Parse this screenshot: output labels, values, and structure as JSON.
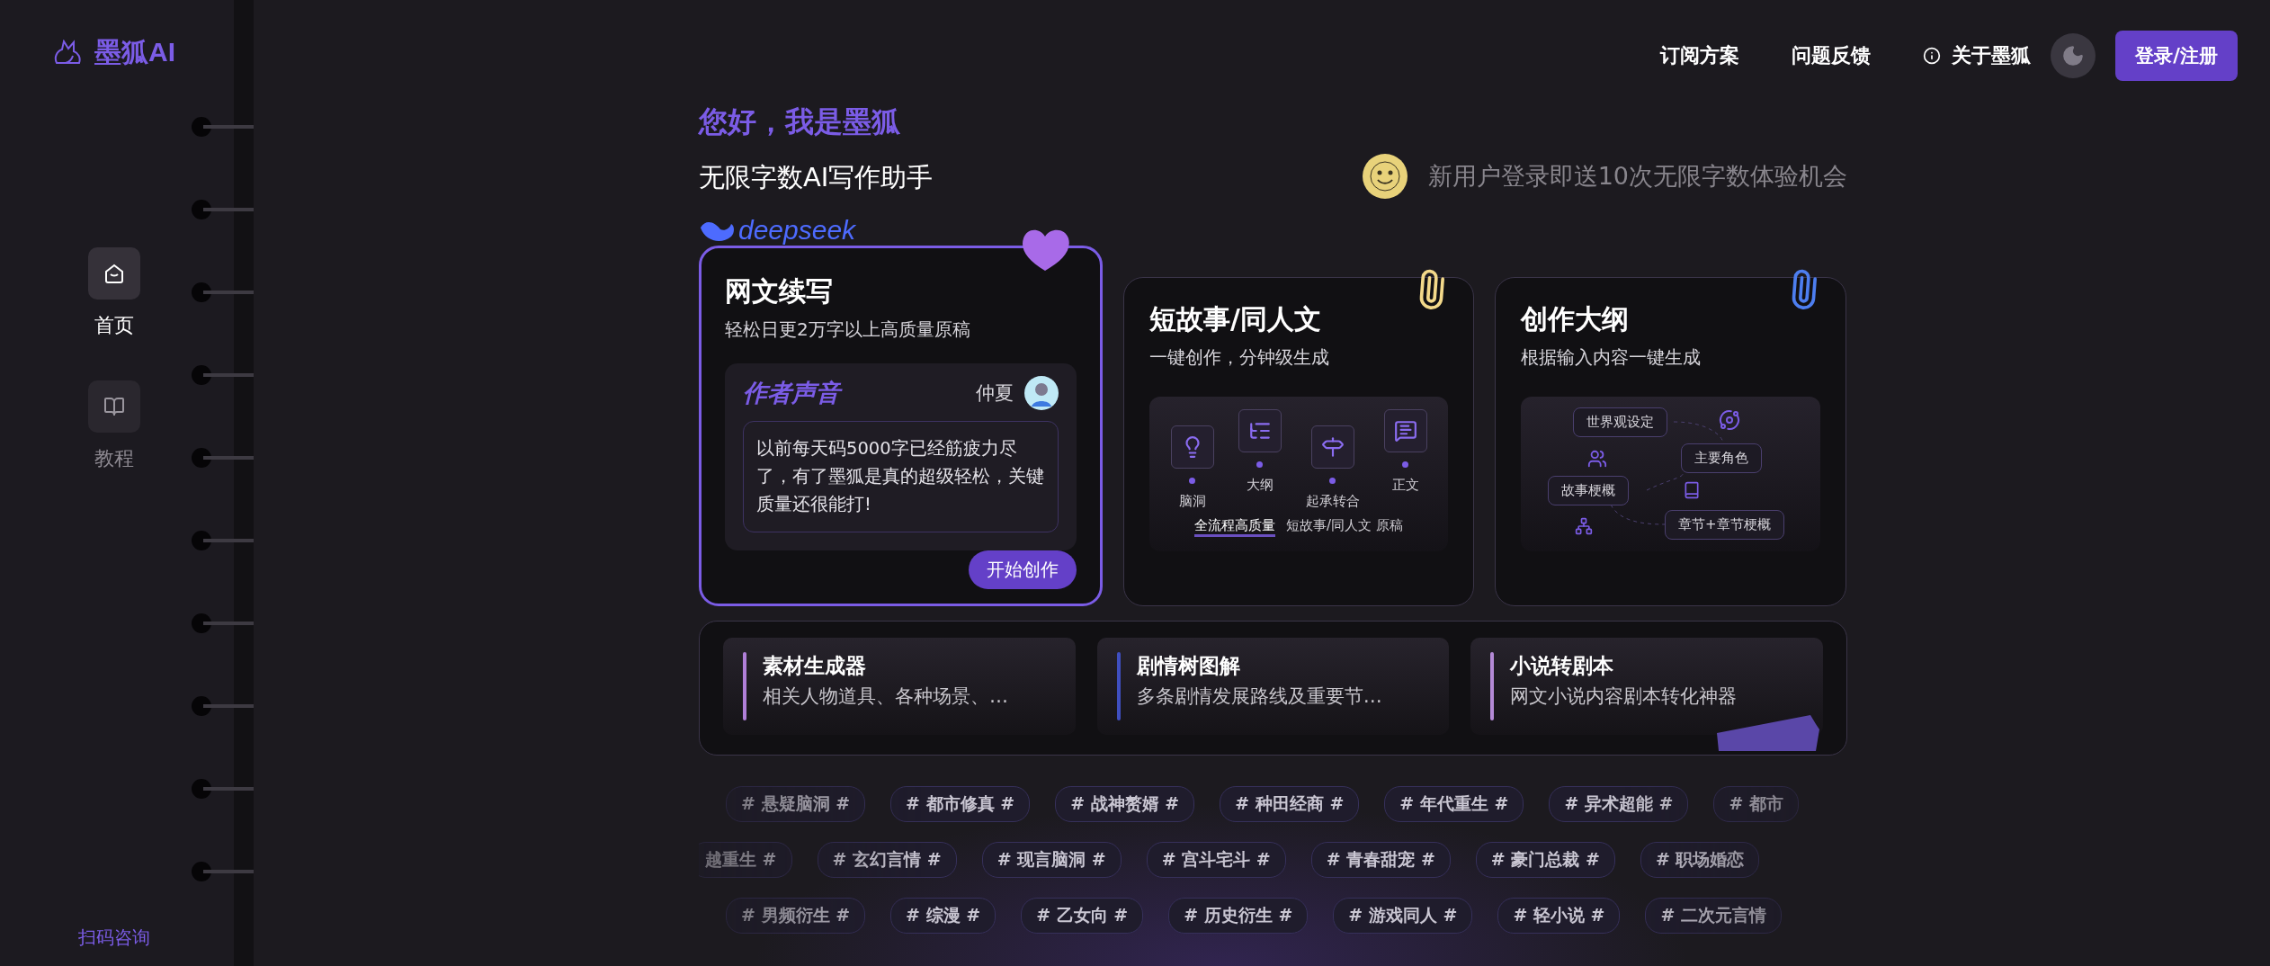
{
  "brand": {
    "name": "墨狐AI"
  },
  "sidebar": {
    "items": [
      {
        "label": "首页",
        "selected": true
      },
      {
        "label": "教程",
        "selected": false
      }
    ],
    "footer_link": "扫码咨询"
  },
  "nav": {
    "links": [
      {
        "label": "订阅方案",
        "kind": "plain"
      },
      {
        "label": "问题反馈",
        "kind": "plain"
      },
      {
        "label": "关于墨狐",
        "kind": "info"
      }
    ],
    "login_button": "登录/注册"
  },
  "hero": {
    "greeting": "您好，我是墨狐",
    "tagline": "无限字数AI写作助手",
    "model_badge": "deepseek",
    "promo": "新用户登录即送10次无限字数体验机会"
  },
  "feature_cards": [
    {
      "kind": "testimonial",
      "selected": true,
      "title": "网文续写",
      "subtitle": "轻松日更2万字以上高质量原稿",
      "voice_label": "作者声音",
      "author": "仲夏",
      "quote": "以前每天码5000字已经筋疲力尽了，有了墨狐是真的超级轻松，关键质量还很能打!",
      "button": "开始创作"
    },
    {
      "kind": "pipeline",
      "selected": false,
      "title": "短故事/同人文",
      "subtitle": "一键创作，分钟级生成",
      "steps": [
        "脑洞",
        "大纲",
        "起承转合",
        "正文"
      ],
      "caption_highlight": "全流程高质量",
      "caption": "短故事/同人文 原稿"
    },
    {
      "kind": "mindmap",
      "selected": false,
      "title": "创作大纲",
      "subtitle": "根据输入内容一键生成",
      "nodes": [
        "世界观设定",
        "主要角色",
        "故事梗概",
        "章节+章节梗概"
      ]
    }
  ],
  "tools": [
    {
      "title": "素材生成器",
      "description": "相关人物道具、各种场景、…",
      "color": "#b07fd8"
    },
    {
      "title": "剧情树图解",
      "description": "多条剧情发展路线及重要节…",
      "color": "#3f4fc0"
    },
    {
      "title": "小说转剧本",
      "description": "网文小说内容剧本转化神器",
      "color": "#b48ad6"
    }
  ],
  "tag_rows": [
    {
      "tags": [
        "# 悬疑脑洞 #",
        "# 都市修真 #",
        "# 战神赘婿 #",
        "# 种田经商 #",
        "# 年代重生 #",
        "# 异术超能 #",
        "# 都市"
      ]
    },
    {
      "tags": [
        "越重生 #",
        "# 玄幻言情 #",
        "# 现言脑洞 #",
        "# 宫斗宅斗 #",
        "# 青春甜宠 #",
        "# 豪门总裁 #",
        "# 职场婚恋"
      ]
    },
    {
      "tags": [
        "# 男频衍生 #",
        "# 综漫 #",
        "# 乙女向 #",
        "# 历史衍生 #",
        "# 游戏同人 #",
        "# 轻小说 #",
        "# 二次元言情"
      ]
    }
  ]
}
